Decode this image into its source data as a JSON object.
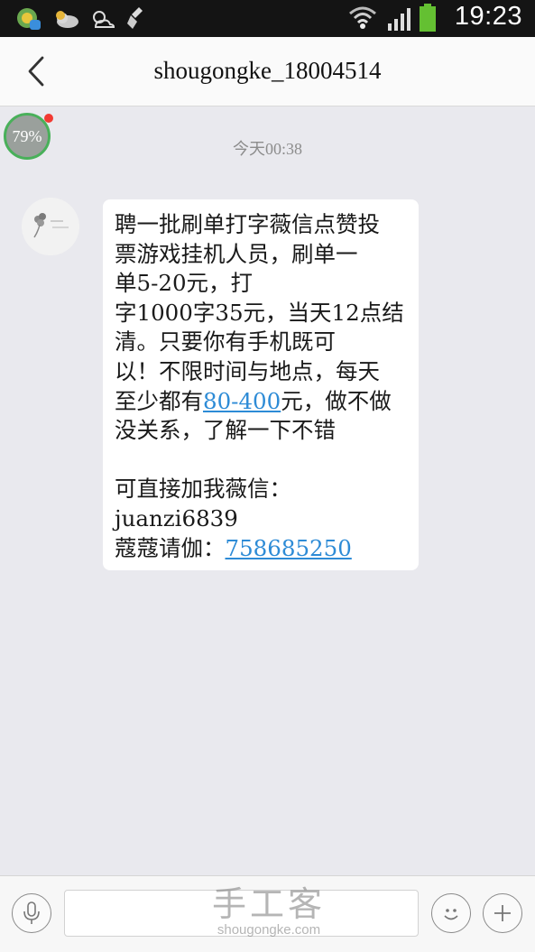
{
  "status_bar": {
    "time": "19:23",
    "icons": [
      "app-notification-icon",
      "cloudy-weather-icon",
      "sun-cloud-icon",
      "cleaner-icon",
      "wifi-icon",
      "signal-icon",
      "battery-icon"
    ]
  },
  "header": {
    "title": "shougongke_18004514"
  },
  "float_ball": {
    "percent": "79%"
  },
  "chat": {
    "timestamp": "今天00:38",
    "message": {
      "lines": [
        "聘一批刷单打字薇信点赞投",
        "票游戏挂机人员，刷单一",
        "单5-20元，打",
        "字1000字35元，当天12点结",
        "清。只要你有手机既可",
        "以！不限时间与地点，每天"
      ],
      "line7_prefix": "至少都有",
      "line7_link": "80-400",
      "line7_suffix": "元，做不做",
      "line8": "没关系，了解一下不错",
      "contact_label": "可直接加我薇信：",
      "contact_wechat": "juanzi6839",
      "qq_prefix": "蔻蔻请伽：",
      "qq_link": "758685250"
    }
  },
  "watermark": {
    "brand": "手工客",
    "url": "shougongke.com"
  },
  "colors": {
    "status_bar": "#141414",
    "background": "#e9e9ee",
    "link": "#2d8bd6"
  }
}
